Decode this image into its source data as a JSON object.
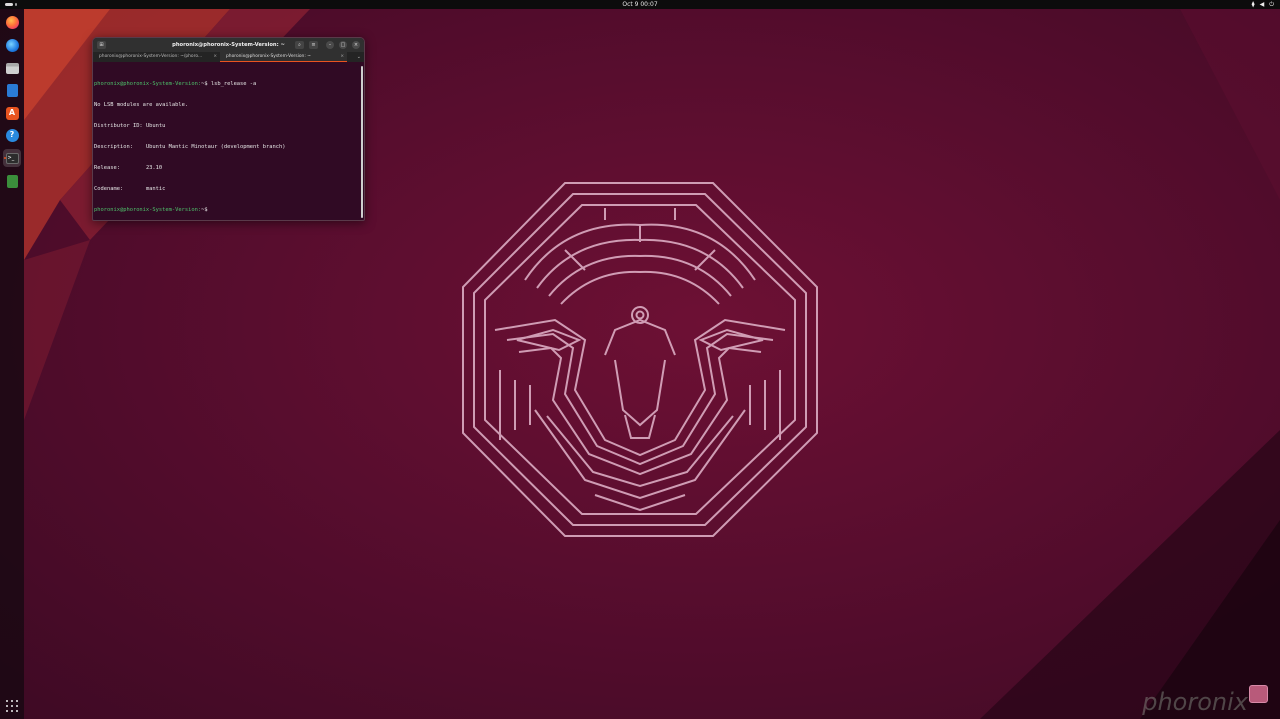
{
  "topbar": {
    "clock": "Oct 9  00:07",
    "tray_icons": [
      "network-icon",
      "volume-icon",
      "power-icon"
    ]
  },
  "dock": {
    "items": [
      {
        "name": "firefox",
        "icon": "firefox-icon"
      },
      {
        "name": "thunderbird",
        "icon": "thunderbird-icon"
      },
      {
        "name": "files",
        "icon": "files-icon"
      },
      {
        "name": "libreoffice-writer",
        "icon": "writer-icon"
      },
      {
        "name": "app-center",
        "icon": "store-icon"
      },
      {
        "name": "help",
        "icon": "help-icon",
        "glyph": "?"
      },
      {
        "name": "terminal",
        "icon": "terminal-icon",
        "active": true
      },
      {
        "name": "trash",
        "icon": "trash-icon"
      }
    ],
    "show_apps_icon": "apps-grid-icon"
  },
  "terminal": {
    "title": "phoronix@phoronix-System-Version: ~",
    "tabs": [
      {
        "label": "phoronix@phoronix-System-Version: ~/phoro..."
      },
      {
        "label": "phoronix@phoronix-System-Version: ~",
        "active": true
      }
    ],
    "lines": [
      {
        "prompt": "phoronix@phoronix-System-Version:",
        "rest": "~$ lsb_release -a"
      },
      {
        "prompt": "",
        "rest": "No LSB modules are available."
      },
      {
        "prompt": "",
        "rest": "Distributor ID:\tUbuntu"
      },
      {
        "prompt": "",
        "rest": "Description:\tUbuntu Mantic Minotaur (development branch)"
      },
      {
        "prompt": "",
        "rest": "Release:\t23.10"
      },
      {
        "prompt": "",
        "rest": "Codename:\tmantic"
      },
      {
        "prompt": "phoronix@phoronix-System-Version:",
        "rest": "~$ "
      }
    ]
  },
  "watermark": "phoronix",
  "colors": {
    "ubuntu_orange": "#E95420",
    "terminal_bg": "#300A24",
    "prompt_green": "#4EC26B",
    "emblem_stroke": "#D9A9C0"
  }
}
